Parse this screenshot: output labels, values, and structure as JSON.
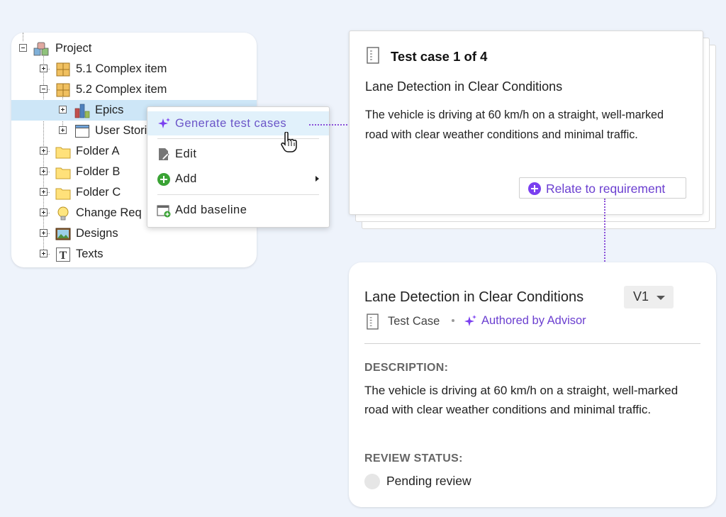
{
  "tree": {
    "root_label": "Project",
    "items": [
      {
        "label": "5.1 Complex item"
      },
      {
        "label": "5.2 Complex item"
      },
      {
        "label": "Epics"
      },
      {
        "label": "User Stori"
      },
      {
        "label": "Folder A"
      },
      {
        "label": "Folder B"
      },
      {
        "label": "Folder C"
      },
      {
        "label": "Change Req"
      },
      {
        "label": "Designs"
      },
      {
        "label": "Texts"
      }
    ]
  },
  "context_menu": {
    "items": [
      {
        "label": "Generate test cases",
        "icon": "sparkle-icon",
        "highlighted": true
      },
      {
        "label": "Edit",
        "icon": "edit-document-icon"
      },
      {
        "label": "Add",
        "icon": "add-circle-icon",
        "has_submenu": true
      },
      {
        "label": "Add baseline",
        "icon": "add-baseline-icon"
      }
    ]
  },
  "test_case_card": {
    "title": "Test case 1 of 4",
    "heading": "Lane Detection in Clear Conditions",
    "description": "The vehicle is driving at 60 km/h on a straight, well-marked road with clear weather conditions and minimal traffic.",
    "relate_label": "Relate to requirement"
  },
  "detail": {
    "title": "Lane Detection in Clear Conditions",
    "version": "V1",
    "type": "Test Case",
    "author": "Authored by Advisor",
    "description_label": "DESCRIPTION:",
    "description": "The vehicle is driving at 60 km/h on a straight, well-marked road with clear weather conditions and minimal traffic.",
    "review_label": "REVIEW STATUS:",
    "review_status": "Pending review"
  },
  "colors": {
    "accent_purple": "#7a3ff0",
    "selection_blue": "#cde6f7",
    "background": "#eef3fb"
  }
}
